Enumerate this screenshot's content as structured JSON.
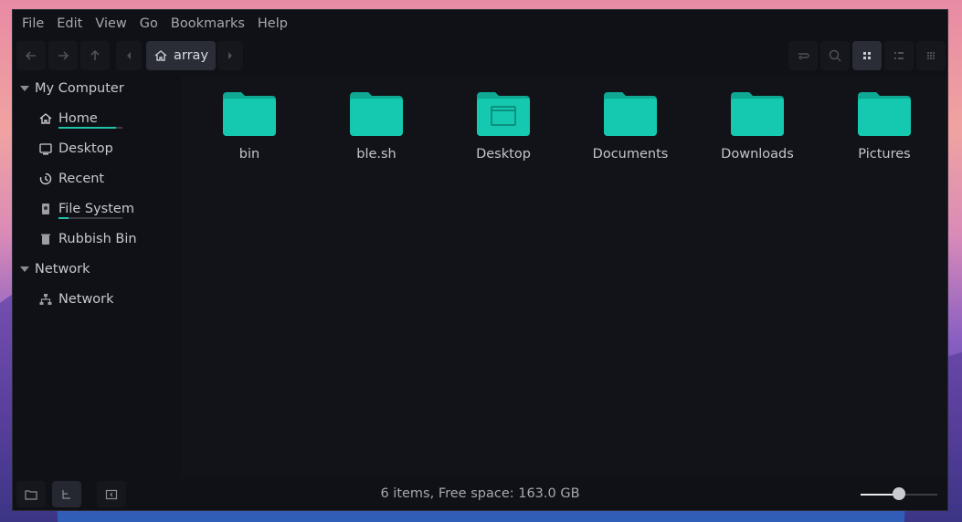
{
  "menubar": {
    "items": [
      "File",
      "Edit",
      "View",
      "Go",
      "Bookmarks",
      "Help"
    ]
  },
  "toolbar": {
    "breadcrumb_label": "array",
    "icons": [
      "back-icon",
      "forward-icon",
      "up-icon",
      "prev-crumb-icon",
      "home-icon",
      "next-crumb-icon",
      "toggle-location-icon",
      "search-icon",
      "icon-view-icon",
      "list-view-icon",
      "compact-view-icon"
    ],
    "active_view": "icon-view"
  },
  "sidebar": {
    "sections": [
      {
        "label": "My Computer",
        "items": [
          {
            "label": "Home",
            "icon": "home-icon",
            "usage": 0.9
          },
          {
            "label": "Desktop",
            "icon": "desktop-icon"
          },
          {
            "label": "Recent",
            "icon": "recent-icon"
          },
          {
            "label": "File System",
            "icon": "drive-icon",
            "usage": 0.15
          },
          {
            "label": "Rubbish Bin",
            "icon": "trash-icon"
          }
        ]
      },
      {
        "label": "Network",
        "items": [
          {
            "label": "Network",
            "icon": "network-icon"
          }
        ]
      }
    ]
  },
  "files": [
    {
      "name": "bin",
      "icon": "folder-icon"
    },
    {
      "name": "ble.sh",
      "icon": "folder-icon"
    },
    {
      "name": "Desktop",
      "icon": "desktop-folder-icon"
    },
    {
      "name": "Documents",
      "icon": "folder-icon"
    },
    {
      "name": "Downloads",
      "icon": "folder-icon"
    },
    {
      "name": "Pictures",
      "icon": "folder-icon"
    }
  ],
  "statusbar": {
    "text": "6 items, Free space: 163.0 GB",
    "zoom_level": 0.5
  },
  "colors": {
    "folder": "#14c9b0",
    "folder_tab": "#0fa894",
    "usage_bar": "#1ec2a8"
  }
}
